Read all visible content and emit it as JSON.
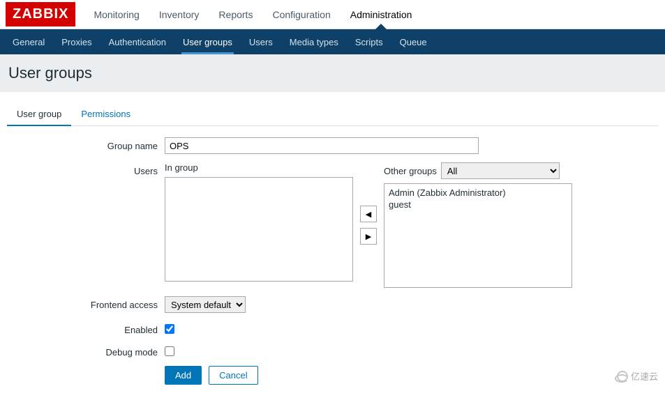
{
  "logo": "ZABBIX",
  "mainnav": [
    {
      "label": "Monitoring",
      "active": false
    },
    {
      "label": "Inventory",
      "active": false
    },
    {
      "label": "Reports",
      "active": false
    },
    {
      "label": "Configuration",
      "active": false
    },
    {
      "label": "Administration",
      "active": true
    }
  ],
  "subnav": [
    {
      "label": "General",
      "active": false
    },
    {
      "label": "Proxies",
      "active": false
    },
    {
      "label": "Authentication",
      "active": false
    },
    {
      "label": "User groups",
      "active": true
    },
    {
      "label": "Users",
      "active": false
    },
    {
      "label": "Media types",
      "active": false
    },
    {
      "label": "Scripts",
      "active": false
    },
    {
      "label": "Queue",
      "active": false
    }
  ],
  "page_title": "User groups",
  "tabs": [
    {
      "label": "User group",
      "active": true
    },
    {
      "label": "Permissions",
      "active": false
    }
  ],
  "form": {
    "group_name": {
      "label": "Group name",
      "value": "OPS"
    },
    "users": {
      "label": "Users",
      "in_group_label": "In group",
      "in_group_items": [],
      "other_groups_label": "Other groups",
      "other_groups_selected": "All",
      "other_items": [
        "Admin (Zabbix Administrator)",
        "guest"
      ]
    },
    "frontend_access": {
      "label": "Frontend access",
      "value": "System default"
    },
    "enabled": {
      "label": "Enabled",
      "checked": true
    },
    "debug_mode": {
      "label": "Debug mode",
      "checked": false
    }
  },
  "buttons": {
    "add": "Add",
    "cancel": "Cancel"
  },
  "watermark": "亿速云"
}
